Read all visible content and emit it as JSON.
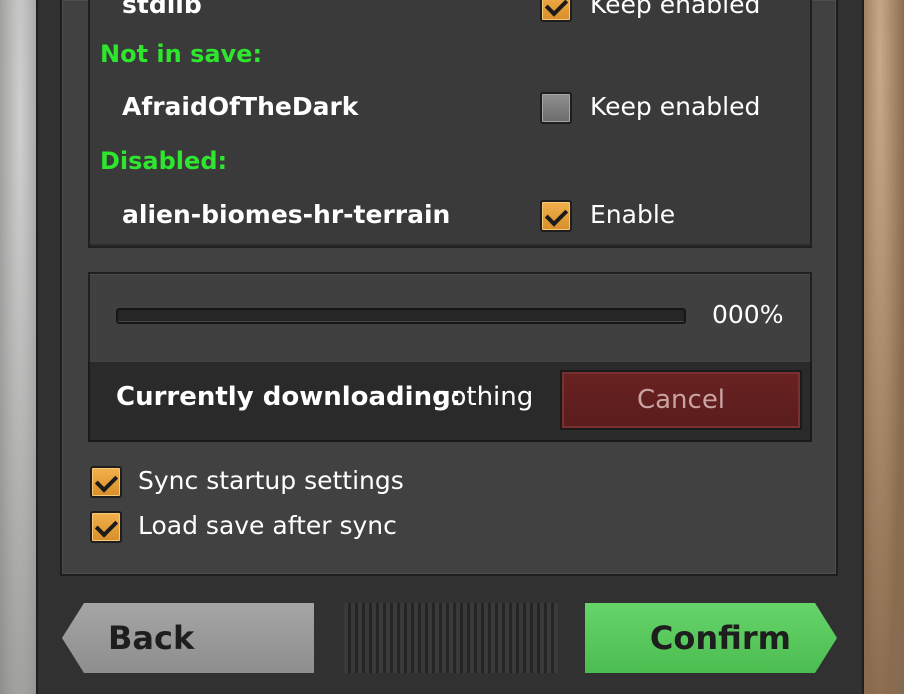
{
  "mod_list": {
    "items": [
      {
        "name": "stdlib",
        "checked": true,
        "action_label": "Keep enabled"
      },
      {
        "section": "Not in save:"
      },
      {
        "name": "AfraidOfTheDark",
        "checked": false,
        "action_label": "Keep enabled"
      },
      {
        "section": "Disabled:"
      },
      {
        "name": "alien-biomes-hr-terrain",
        "checked": true,
        "action_label": "Enable"
      }
    ]
  },
  "download": {
    "progress_text": "000%",
    "progress_value": 0,
    "label": "Currently downloading:",
    "value": "nothing",
    "cancel_label": "Cancel"
  },
  "options": [
    {
      "label": "Sync startup settings",
      "checked": true
    },
    {
      "label": "Load save after sync",
      "checked": true
    }
  ],
  "footer": {
    "back_label": "Back",
    "confirm_label": "Confirm"
  },
  "colors": {
    "section_header": "#2ee62e",
    "checkbox_checked": "#e8a03a",
    "confirm": "#5acb5e",
    "cancel": "#5e1e1e"
  }
}
